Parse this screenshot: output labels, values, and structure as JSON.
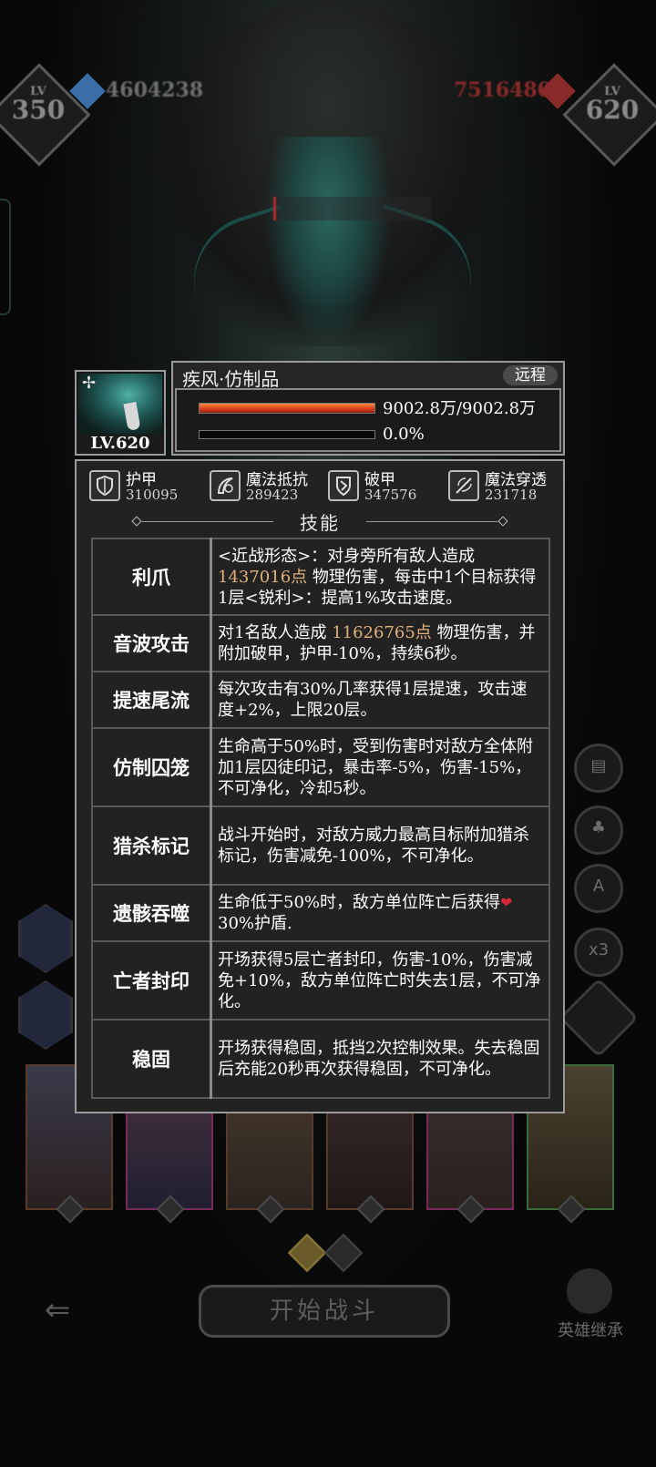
{
  "hud": {
    "player_level": "350",
    "player_level_prefix": "LV",
    "player_power": "4604238",
    "enemy_power": "7516480",
    "enemy_level": "620",
    "enemy_level_prefix": "LV"
  },
  "side_buttons": [
    "x3"
  ],
  "bottom": {
    "start_battle": "开始战斗",
    "hero_inherit": "英雄继承"
  },
  "enemy": {
    "name": "疾风·仿制品",
    "range": "远程",
    "level": "LV.620",
    "hp_text": "9002.8万/9002.8万",
    "hp_ratio": 1.0,
    "shield_text": "0.0%",
    "shield_ratio": 0.0
  },
  "stats": [
    {
      "label": "护甲",
      "value": "310095",
      "icon": "armor-shield-icon"
    },
    {
      "label": "魔法抵抗",
      "value": "289423",
      "icon": "magic-resist-icon"
    },
    {
      "label": "破甲",
      "value": "347576",
      "icon": "armor-break-icon"
    },
    {
      "label": "魔法穿透",
      "value": "231718",
      "icon": "magic-penetration-icon"
    }
  ],
  "skills_title": "技能",
  "skills": [
    {
      "name": "利爪",
      "pre": "<近战形态>：对身旁所有敌人造成",
      "num": "1437016点",
      "post": " 物理伤害，每击中1个目标获得1层<锐利>：提高1%攻击速度。"
    },
    {
      "name": "音波攻击",
      "pre": "对1名敌人造成 ",
      "num": "11626765点",
      "post": " 物理伤害，并附加破甲，护甲-10%，持续6秒。"
    },
    {
      "name": "提速尾流",
      "pre": "每次攻击有30%几率获得1层提速，攻击速度+2%，上限20层。",
      "num": "",
      "post": ""
    },
    {
      "name": "仿制囚笼",
      "pre": "生命高于50%时，受到伤害时对敌方全体附加1层囚徒印记，暴击率-5%，伤害-15%，不可净化，冷却5秒。",
      "num": "",
      "post": ""
    },
    {
      "name": "猎杀标记",
      "pre": "战斗开始时，对敌方威力最高目标附加猎杀标记，伤害减免-100%，不可净化。",
      "num": "",
      "post": ""
    },
    {
      "name": "遗骸吞噬",
      "pre": "生命低于50%时，敌方单位阵亡后获得",
      "num": "",
      "post": "30%护盾."
    },
    {
      "name": "亡者封印",
      "pre": "开场获得5层亡者封印，伤害-10%，伤害减免+10%，敌方单位阵亡时失去1层，不可净化。",
      "num": "",
      "post": ""
    },
    {
      "name": "稳固",
      "pre": "开场获得稳固，抵挡2次控制效果。失去稳固后充能20秒再次获得稳固，不可净化。",
      "num": "",
      "post": ""
    }
  ]
}
